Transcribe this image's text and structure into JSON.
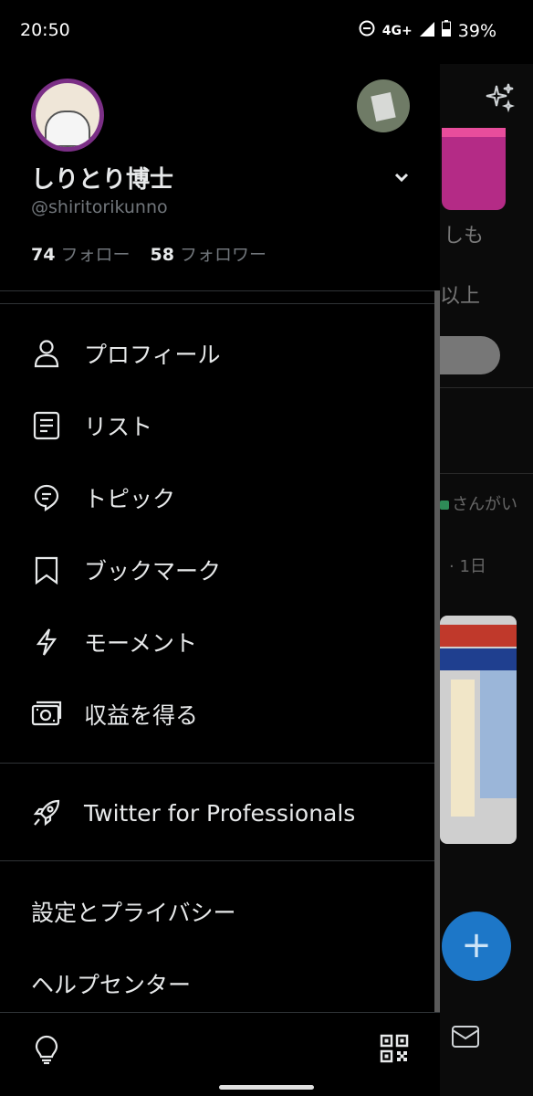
{
  "status": {
    "time": "20:50",
    "network": "4G+",
    "battery": "39%"
  },
  "profile": {
    "name": "しりとり博士",
    "handle": "@shiritorikunno",
    "following_count": "74",
    "following_label": "フォロー",
    "followers_count": "58",
    "followers_label": "フォロワー"
  },
  "menu": {
    "items": [
      {
        "label": "プロフィール",
        "icon": "person-icon"
      },
      {
        "label": "リスト",
        "icon": "list-icon"
      },
      {
        "label": "トピック",
        "icon": "topic-icon"
      },
      {
        "label": "ブックマーク",
        "icon": "bookmark-icon"
      },
      {
        "label": "モーメント",
        "icon": "lightning-icon"
      },
      {
        "label": "収益を得る",
        "icon": "money-icon"
      }
    ],
    "professionals": "Twitter for Professionals",
    "settings": "設定とプライバシー",
    "help": "ヘルプセンター"
  },
  "background": {
    "text1": "しも",
    "text2": "以上",
    "user": "さんがい",
    "time_ago": "· 1日",
    "fab": "+"
  },
  "colors": {
    "accent": "#1d9bf0",
    "text": "#e7e9ea",
    "muted": "#71767b"
  }
}
